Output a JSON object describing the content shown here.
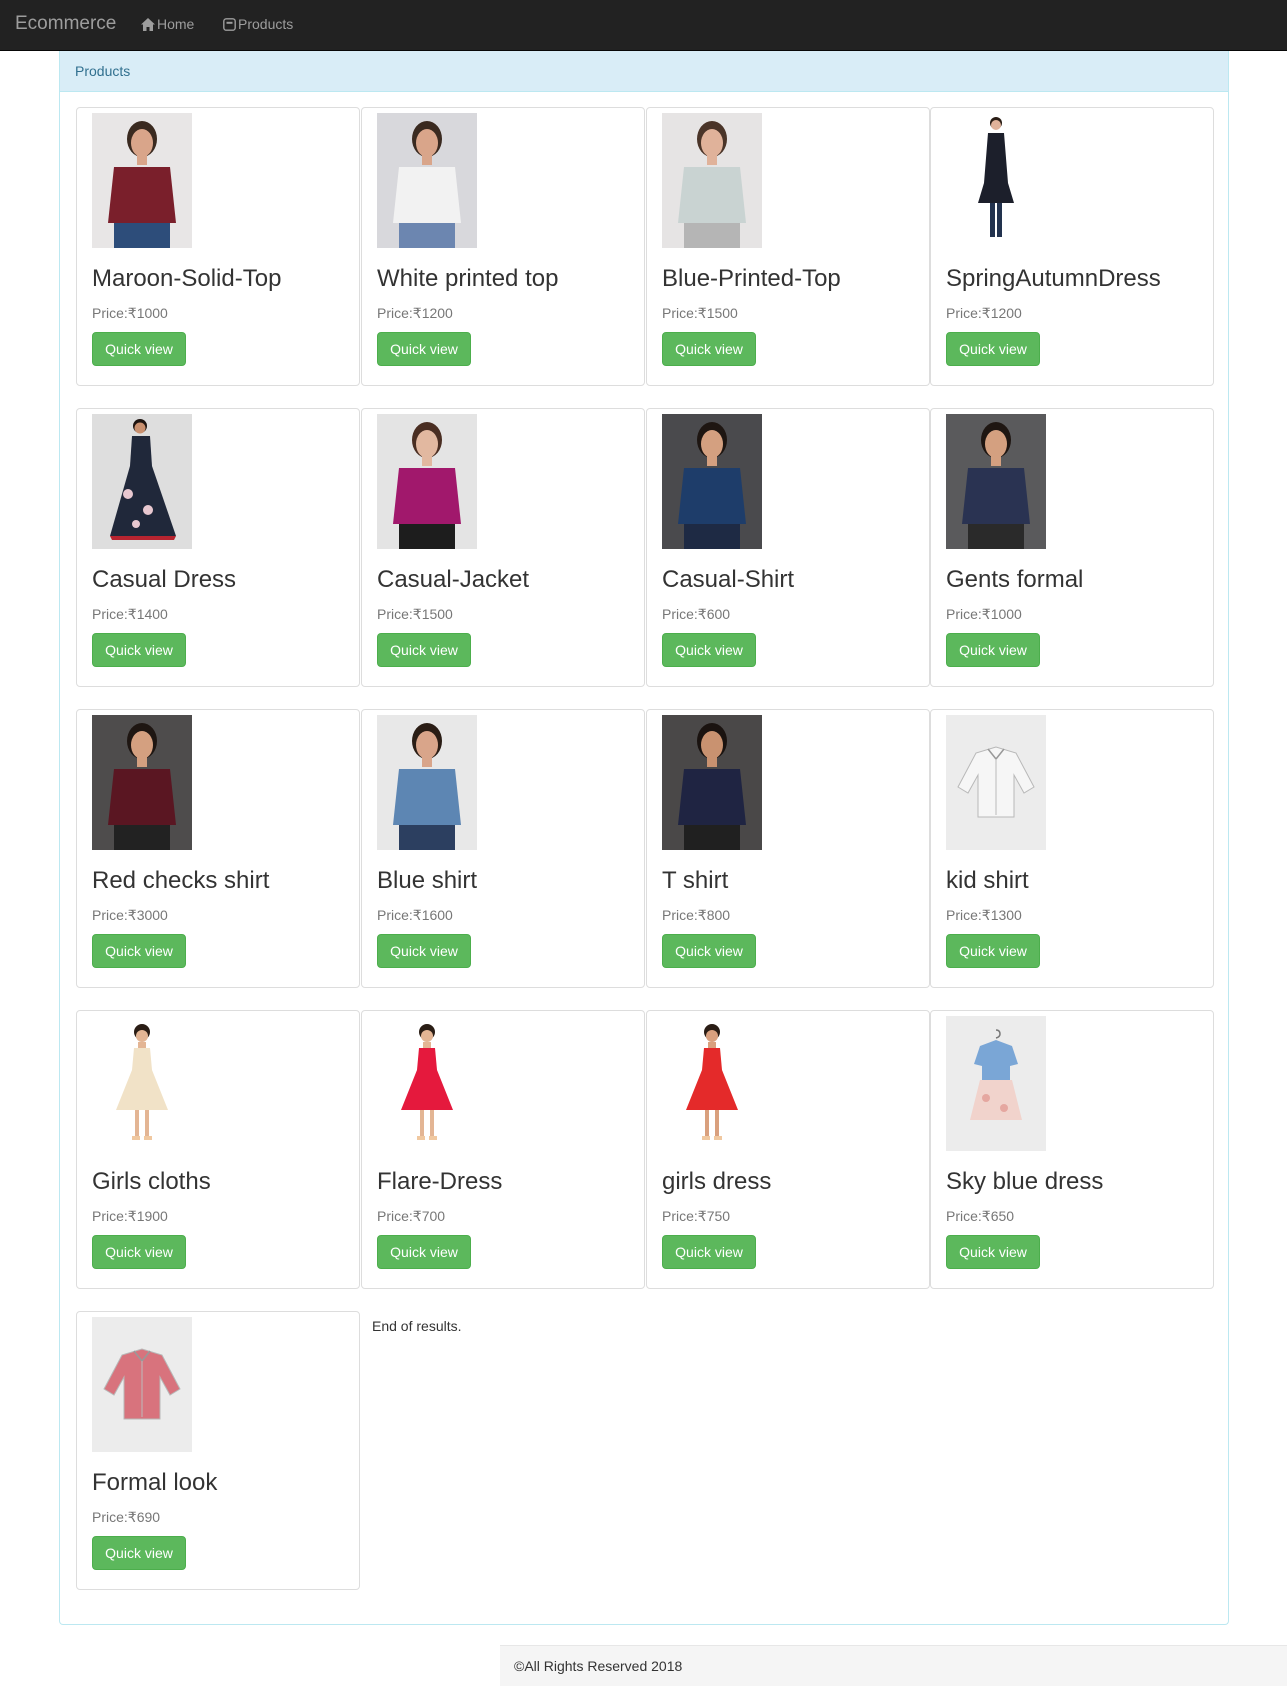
{
  "navbar": {
    "brand": "Ecommerce",
    "links": [
      {
        "label": "Home",
        "icon": "home-icon"
      },
      {
        "label": "Products",
        "icon": "products-icon"
      }
    ]
  },
  "panel": {
    "heading": "Products"
  },
  "products": [
    {
      "name": "Maroon-Solid-Top",
      "price": "Price:₹1000",
      "button": "Quick view",
      "bg": "#e8e6e6",
      "fg": "#7a1f2b",
      "skin": "#d9a58a",
      "hair": "#3a2a20",
      "bottom": "#2d4d7a",
      "kind": "woman"
    },
    {
      "name": "White printed top",
      "price": "Price:₹1200",
      "button": "Quick view",
      "bg": "#d8d8dc",
      "fg": "#f2f2f2",
      "skin": "#d9a58a",
      "hair": "#3a2a20",
      "bottom": "#6c86b0",
      "kind": "woman"
    },
    {
      "name": "Blue-Printed-Top",
      "price": "Price:₹1500",
      "button": "Quick view",
      "bg": "#e6e4e4",
      "fg": "#c9d3d2",
      "skin": "#e0b29a",
      "hair": "#4a3428",
      "bottom": "#b5b5b5",
      "kind": "woman"
    },
    {
      "name": "SpringAutumnDress",
      "price": "Price:₹1200",
      "button": "Quick view",
      "bg": "#ffffff",
      "fg": "#1c1f2b",
      "skin": "#e0b29a",
      "hair": "#2a1d15",
      "bottom": "#1c1f2b",
      "kind": "coat"
    },
    {
      "name": "Casual Dress",
      "price": "Price:₹1400",
      "button": "Quick view",
      "bg": "#dedede",
      "fg": "#20283a",
      "skin": "#c9906f",
      "hair": "#1e1410",
      "bottom": "#b72430",
      "kind": "dress"
    },
    {
      "name": "Casual-Jacket",
      "price": "Price:₹1500",
      "button": "Quick view",
      "bg": "#e4e4e4",
      "fg": "#a1186c",
      "skin": "#e2b8a0",
      "hair": "#4a2e22",
      "bottom": "#1d1d1d",
      "kind": "woman"
    },
    {
      "name": "Casual-Shirt",
      "price": "Price:₹600",
      "button": "Quick view",
      "bg": "#4a4a4d",
      "fg": "#1e3d6a",
      "skin": "#d4a080",
      "hair": "#1e1612",
      "bottom": "#1e2a44",
      "kind": "man"
    },
    {
      "name": "Gents formal",
      "price": "Price:₹1000",
      "button": "Quick view",
      "bg": "#5a5a5c",
      "fg": "#2a3352",
      "skin": "#d4a080",
      "hair": "#1e1612",
      "bottom": "#2a2a2a",
      "kind": "man"
    },
    {
      "name": "Red checks shirt",
      "price": "Price:₹3000",
      "button": "Quick view",
      "bg": "#4e4c4c",
      "fg": "#5a1622",
      "skin": "#d4a080",
      "hair": "#1e1612",
      "bottom": "#222222",
      "kind": "man"
    },
    {
      "name": "Blue shirt",
      "price": "Price:₹1600",
      "button": "Quick view",
      "bg": "#e8e8e8",
      "fg": "#5d86b3",
      "skin": "#d9a58a",
      "hair": "#2a1d15",
      "bottom": "#2c3f60",
      "kind": "man"
    },
    {
      "name": "T shirt",
      "price": "Price:₹800",
      "button": "Quick view",
      "bg": "#4a4848",
      "fg": "#1f2442",
      "skin": "#c99270",
      "hair": "#1a1310",
      "bottom": "#202020",
      "kind": "man"
    },
    {
      "name": "kid shirt",
      "price": "Price:₹1300",
      "button": "Quick view",
      "bg": "#ececec",
      "fg": "#f6f6f6",
      "skin": "#ececec",
      "hair": "#ececec",
      "bottom": "#ececec",
      "kind": "shirt"
    },
    {
      "name": "Girls cloths",
      "price": "Price:₹1900",
      "button": "Quick view",
      "bg": "#ffffff",
      "fg": "#f1e2c7",
      "skin": "#e3b594",
      "hair": "#2a1d15",
      "bottom": "#e3b594",
      "kind": "girl"
    },
    {
      "name": "Flare-Dress",
      "price": "Price:₹700",
      "button": "Quick view",
      "bg": "#ffffff",
      "fg": "#e5193d",
      "skin": "#e3b594",
      "hair": "#2a1d15",
      "bottom": "#e3b594",
      "kind": "girl"
    },
    {
      "name": "girls dress",
      "price": "Price:₹750",
      "button": "Quick view",
      "bg": "#ffffff",
      "fg": "#e42a2a",
      "skin": "#d9a07e",
      "hair": "#2a1d15",
      "bottom": "#d9a07e",
      "kind": "girl"
    },
    {
      "name": "Sky blue dress",
      "price": "Price:₹650",
      "button": "Quick view",
      "bg": "#ececec",
      "fg": "#7aa6d6",
      "skin": "#ececec",
      "hair": "#ececec",
      "bottom": "#f1d3cc",
      "kind": "hanger"
    },
    {
      "name": "Formal look",
      "price": "Price:₹690",
      "button": "Quick view",
      "bg": "#ececec",
      "fg": "#d8737d",
      "skin": "#ececec",
      "hair": "#ececec",
      "bottom": "#ececec",
      "kind": "shirt"
    }
  ],
  "end_text": "End of results.",
  "footer": "©All Rights Reserved 2018"
}
